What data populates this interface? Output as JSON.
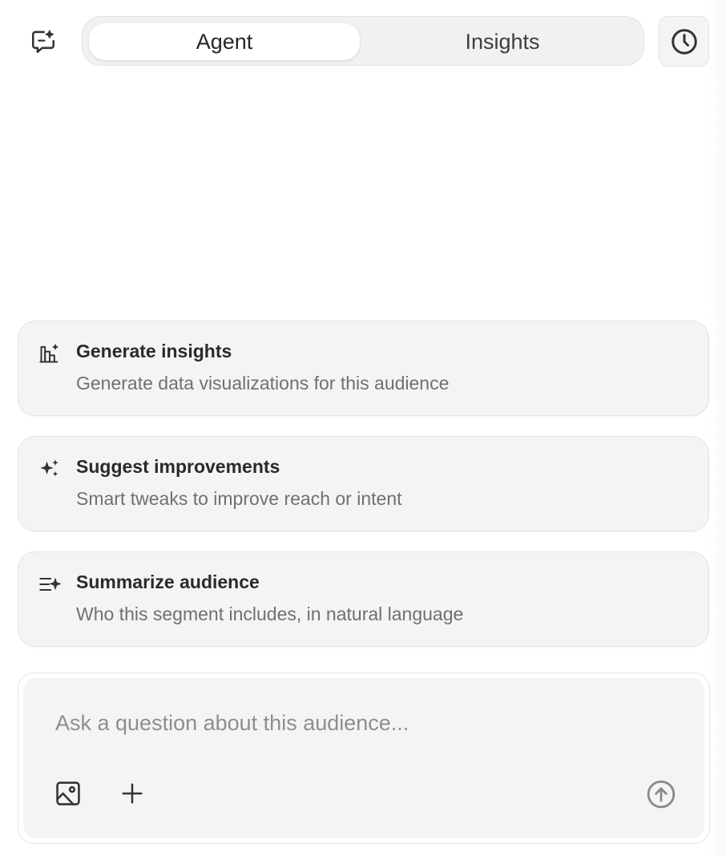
{
  "header": {
    "new_chat_icon": "chat-sparkle-icon",
    "tabs": [
      {
        "label": "Agent",
        "active": true
      },
      {
        "label": "Insights",
        "active": false
      }
    ],
    "history_icon": "clock-icon"
  },
  "suggestions": [
    {
      "icon": "chart-sparkle-icon",
      "title": "Generate insights",
      "description": "Generate data visualizations for this audience"
    },
    {
      "icon": "sparkles-icon",
      "title": "Suggest improvements",
      "description": "Smart tweaks to improve reach or intent"
    },
    {
      "icon": "list-sparkle-icon",
      "title": "Summarize audience",
      "description": "Who this segment includes, in natural language"
    }
  ],
  "composer": {
    "placeholder": "Ask a question about this audience...",
    "value": "",
    "attach_image_icon": "image-icon",
    "add_icon": "plus-icon",
    "send_icon": "arrow-up-circle-icon"
  },
  "colors": {
    "background": "#ffffff",
    "card_background": "#f4f4f4",
    "text_primary": "#2a2a2a",
    "text_secondary": "#707070",
    "placeholder": "#8e8e8e"
  }
}
